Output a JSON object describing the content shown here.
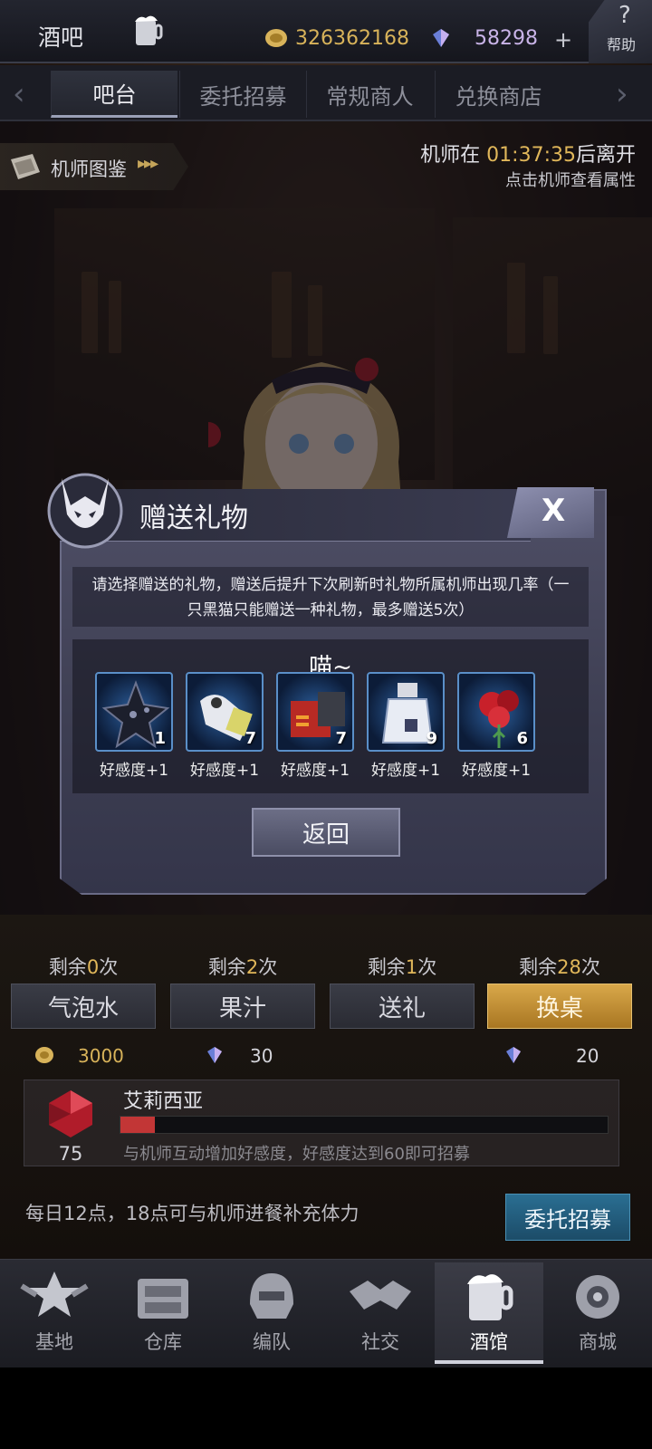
{
  "header": {
    "title": "酒吧",
    "gold": "326362168",
    "gems": "58298",
    "plus": "+",
    "help_q": "?",
    "help_label": "帮助"
  },
  "tabs": [
    {
      "label": "吧台",
      "active": true
    },
    {
      "label": "委托招募"
    },
    {
      "label": "常规商人"
    },
    {
      "label": "兑换商店"
    }
  ],
  "codex": {
    "label": "机师图鉴",
    "arrows": "▸▸▸"
  },
  "timer": {
    "prefix": "机师在 ",
    "time": "01:37:35",
    "suffix": "后离开",
    "hint": "点击机师查看属性"
  },
  "dialog": {
    "title": "赠送礼物",
    "close": "X",
    "description": "请选择赠送的礼物，赠送后提升下次刷新时礼物所属机师出现几率（一只黑猫只能赠送一种礼物，最多赠送5次）",
    "speech": "喵~",
    "items": [
      {
        "count": "1",
        "label": "好感度+1",
        "icon": "dark-star-icon"
      },
      {
        "count": "7",
        "label": "好感度+1",
        "icon": "device-icon"
      },
      {
        "count": "7",
        "label": "好感度+1",
        "icon": "gift-box-icon"
      },
      {
        "count": "9",
        "label": "好感度+1",
        "icon": "perfume-icon"
      },
      {
        "count": "6",
        "label": "好感度+1",
        "icon": "flower-icon"
      }
    ],
    "back": "返回"
  },
  "actions": [
    {
      "remain_prefix": "剩余",
      "remain": "0",
      "remain_suffix": "次",
      "label": "气泡水",
      "cost": "3000",
      "cost_type": "gold"
    },
    {
      "remain_prefix": "剩余",
      "remain": "2",
      "remain_suffix": "次",
      "label": "果汁",
      "cost": "30",
      "cost_type": "gem"
    },
    {
      "remain_prefix": "剩余",
      "remain": "1",
      "remain_suffix": "次",
      "label": "送礼",
      "cost": "",
      "cost_type": ""
    },
    {
      "remain_prefix": "剩余",
      "remain": "28",
      "remain_suffix": "次",
      "label": "换桌",
      "cost": "20",
      "cost_type": "gem"
    }
  ],
  "favor": {
    "level": "75",
    "name": "艾莉西亚",
    "progress_fraction": 0.07,
    "hint": "与机师互动增加好感度，好感度达到60即可招募"
  },
  "meal_hint": "每日12点，18点可与机师进餐补充体力",
  "recruit_button": "委托招募",
  "nav": [
    {
      "label": "基地",
      "icon": "base-icon"
    },
    {
      "label": "仓库",
      "icon": "warehouse-icon"
    },
    {
      "label": "编队",
      "icon": "helmet-icon"
    },
    {
      "label": "社交",
      "icon": "handshake-icon"
    },
    {
      "label": "酒馆",
      "icon": "tavern-icon",
      "active": true
    },
    {
      "label": "商城",
      "icon": "shop-icon"
    }
  ],
  "colors": {
    "gold": "#d8b35a",
    "accent": "#e0b75a",
    "favor_bar": "#c23636",
    "recruit": "#2a6e92"
  }
}
